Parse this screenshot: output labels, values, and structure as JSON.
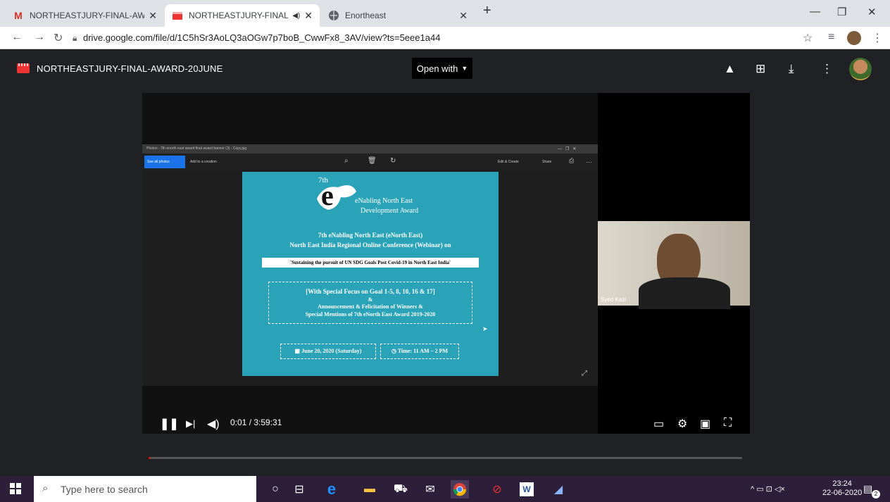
{
  "tabs": [
    {
      "title": "NORTHEASTJURY-FINAL-AWARD",
      "icon": "gmail-icon"
    },
    {
      "title": "NORTHEASTJURY-FINAL-AW",
      "icon": "video-icon"
    },
    {
      "title": "Enortheast",
      "icon": "globe-icon"
    }
  ],
  "address": {
    "url": "drive.google.com/file/d/1C5hSr3AoLQ3aOGw7p7boB_CwwFx8_3AV/view?ts=5eee1a44"
  },
  "drive": {
    "title": "NORTHEASTJURY-FINAL-AWARD-20JUNE",
    "open_with": "Open with"
  },
  "photos": {
    "window_title": "Photos - 7th enorth east award final award banner (3) - Copy.jpg",
    "see_all": "See all photos",
    "add_creation": "Add to a creation",
    "edit_create": "Edit & Create",
    "share": "Share"
  },
  "poster": {
    "ordinal": "7th",
    "brand1": "eNabling North East",
    "brand2": "Development Award",
    "line1": "7th eNabling North East (eNorth East)",
    "line2": "North East India Regional Online Conference (Webinar) on",
    "theme": "'Sustaining the pursuit of UN SDG Goals Post Covid-19 in North East India'",
    "focus": "[With Special Focus on Goal 1-5, 8, 10, 16 & 17]",
    "amp": "&",
    "ann1": "Announcement & Felicitation of Winners &",
    "ann2": "Special Mentions of 7th eNorth East Award 2019-2020",
    "date": "June 20, 2020 (Saturday)",
    "time": "Time: 11 AM – 2 PM"
  },
  "camera": {
    "name": "Syed Kazi"
  },
  "player": {
    "time": "0:01 / 3:59:31",
    "progress_percent": 0.01
  },
  "taskbar": {
    "search_placeholder": "Type here to search",
    "time": "23:24",
    "date": "22-06-2020",
    "notifications": "2"
  }
}
